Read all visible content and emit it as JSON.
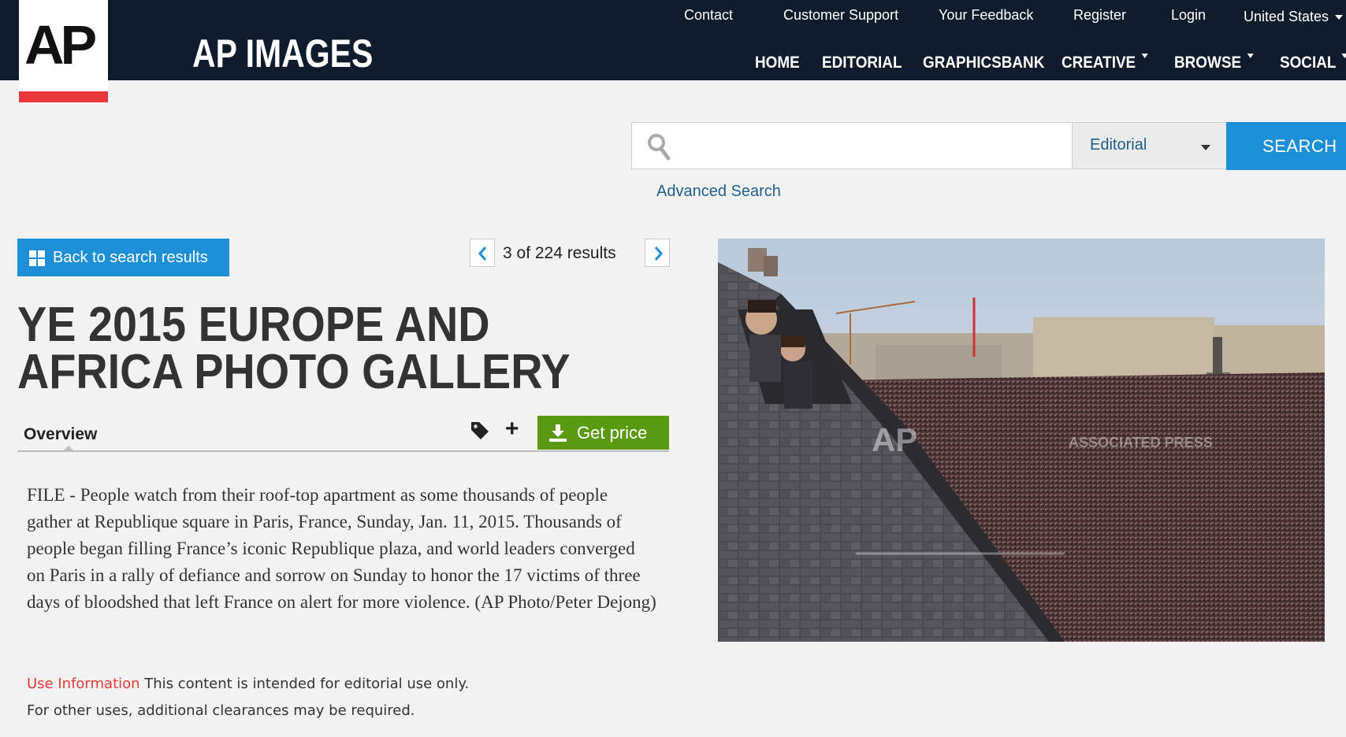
{
  "header": {
    "logo_text": "AP",
    "brand_name": "AP IMAGES",
    "util_nav": [
      "Contact",
      "Customer Support",
      "Your Feedback",
      "Register",
      "Login"
    ],
    "region": "United States",
    "main_nav": [
      "HOME",
      "EDITORIAL",
      "GRAPHICSBANK",
      "CREATIVE",
      "BROWSE",
      "SOCIAL"
    ]
  },
  "search": {
    "value": "",
    "placeholder": "",
    "category": "Editorial",
    "button_label": "SEARCH",
    "advanced_label": "Advanced Search"
  },
  "results": {
    "back_label": "Back to search results",
    "pager_text": "3 of 224 results"
  },
  "gallery": {
    "title": "YE 2015 EUROPE AND AFRICA PHOTO GALLERY",
    "tab_overview": "Overview",
    "price_label": "Get price",
    "caption": "FILE - People watch from their roof-top apartment as some thousands of people gather at Republique square in Paris, France, Sunday, Jan. 11, 2015. Thousands of people began filling France’s iconic Republique plaza, and world leaders converged on Paris in a rally of defiance and sorrow on Sunday to honor the 17 victims of three days of bloodshed that left France on alert for more violence. (AP Photo/Peter Dejong)",
    "use_title": "Use Information",
    "use_text_1": "This content is intended for editorial use only.",
    "use_text_2": "For other uses, additional clearances may be required."
  },
  "photo": {
    "watermark_logo": "AP",
    "watermark_text": "ASSOCIATED PRESS"
  },
  "colors": {
    "header_bg": "#0f1c2e",
    "accent_blue": "#1c8fd6",
    "link_blue": "#1f5d8c",
    "logo_red": "#e8383d",
    "price_green": "#5a9a13",
    "page_bg": "#f2f2f2"
  },
  "icons": {
    "search": "magnifier-icon",
    "grid": "grid-icon",
    "prev": "chevron-left-icon",
    "next": "chevron-right-icon",
    "tag": "tag-icon",
    "plus": "plus-icon",
    "download": "download-icon"
  }
}
